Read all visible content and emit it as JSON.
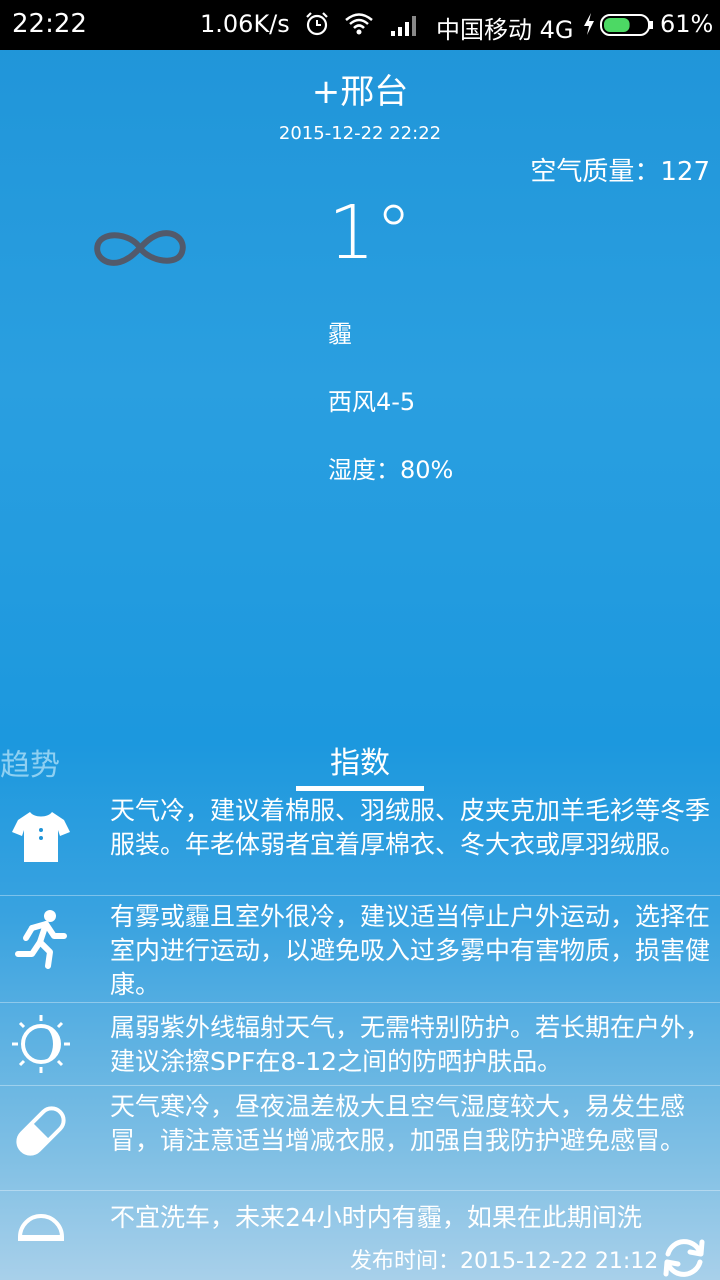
{
  "status_bar": {
    "time": "22:22",
    "net_speed": "1.06K/s",
    "carrier": "中国移动 4G",
    "battery_percent": "61%",
    "battery_level": 0.61,
    "icons": [
      "alarm-icon",
      "wifi-icon",
      "signal-icon",
      "charging-icon",
      "battery-icon"
    ]
  },
  "header": {
    "city": "+邢台",
    "datetime": "2015-12-22  22:22",
    "air_quality": "空气质量：127"
  },
  "current": {
    "temperature": "1°",
    "condition": "霾",
    "wind": "西风4-5",
    "humidity": "湿度：80%",
    "icon": "haze-icon"
  },
  "tabs": {
    "trend": "趋势",
    "index": "指数",
    "active": "index"
  },
  "indices": [
    {
      "icon": "shirt-icon",
      "text": "天气冷，建议着棉服、羽绒服、皮夹克加羊毛衫等冬季服装。年老体弱者宜着厚棉衣、冬大衣或厚羽绒服。"
    },
    {
      "icon": "running-icon",
      "text": "有雾或霾且室外很冷，建议适当停止户外运动，选择在室内进行运动，以避免吸入过多雾中有害物质，损害健康。"
    },
    {
      "icon": "sun-icon",
      "text": "属弱紫外线辐射天气，无需特别防护。若长期在户外，建议涂擦SPF在8-12之间的防晒护肤品。"
    },
    {
      "icon": "pill-icon",
      "text": "天气寒冷，昼夜温差极大且空气湿度较大，易发生感冒，请注意适当增减衣服，加强自我防护避免感冒。"
    },
    {
      "icon": "car-wash-icon",
      "text": "不宜洗车，未来24小时内有霾，如果在此期间洗"
    }
  ],
  "footer": {
    "publish_time": "发布时间：2015-12-22 21:12",
    "refresh_icon": "refresh-icon"
  }
}
